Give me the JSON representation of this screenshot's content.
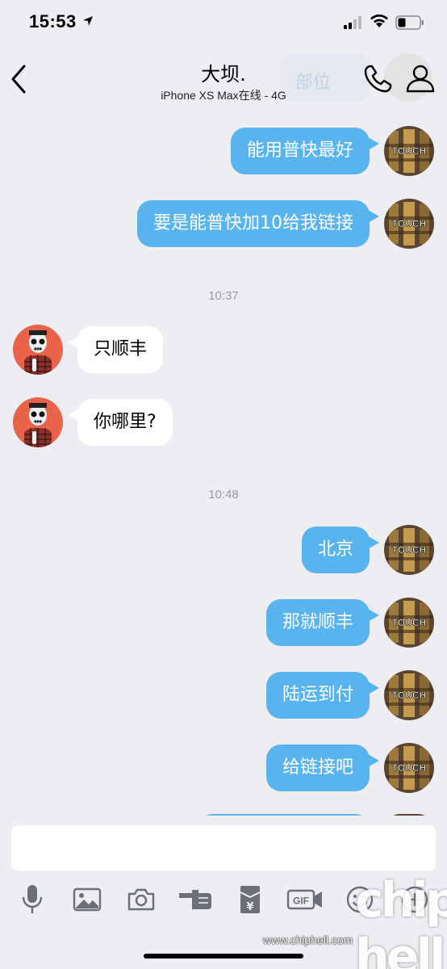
{
  "status_bar": {
    "time": "15:53"
  },
  "nav": {
    "title": "大坝.",
    "subtitle": "iPhone XS Max在线 - 4G",
    "ghost_text": "部位"
  },
  "messages": [
    {
      "type": "out",
      "text": "能用普快最好"
    },
    {
      "type": "out",
      "text": "要是能普快加10给我链接"
    },
    {
      "type": "time",
      "text": "10:37"
    },
    {
      "type": "in",
      "text": "只顺丰"
    },
    {
      "type": "in",
      "text": "你哪里?"
    },
    {
      "type": "time",
      "text": "10:48"
    },
    {
      "type": "out",
      "text": "北京"
    },
    {
      "type": "out",
      "text": "那就顺丰"
    },
    {
      "type": "out",
      "text": "陆运到付"
    },
    {
      "type": "out",
      "text": "给链接吧"
    }
  ],
  "self_avatar_text": "TOUCH",
  "toolbar": {
    "icons": [
      "microphone-icon",
      "image-icon",
      "camera-icon",
      "poke-hand-icon",
      "red-packet-icon",
      "gif-icon",
      "emoji-icon",
      "more-icon"
    ],
    "gif_label": "GIF",
    "yen_symbol": "¥"
  },
  "watermark": {
    "url": "www.chiphell.com",
    "logo": "chip hell"
  },
  "colors": {
    "outgoing_bubble": "#58b4ee",
    "incoming_bubble": "#ffffff",
    "background": "#ededf2",
    "other_avatar_bg": "#e8634a"
  }
}
